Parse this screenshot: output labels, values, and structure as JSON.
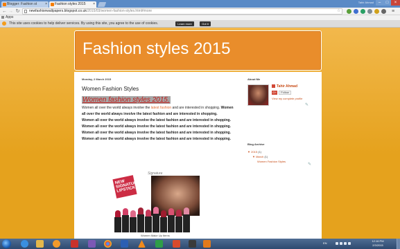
{
  "browser": {
    "tabs": [
      {
        "label": "Blogger: Fashion st"
      },
      {
        "label": "Fashion styles 2015"
      }
    ],
    "user_name": "Tahir Ahmad",
    "url_host": "newfashionwallpapers.blogspot.co.uk",
    "url_path": "/2015/03/women-fashion-styles.html#more",
    "bookmarks_label": "Apps"
  },
  "cookie_bar": {
    "text": "This site uses cookies to help deliver services. By using this site, you agree to the use of cookies.",
    "learn_more": "Learn more",
    "got_it": "Got it"
  },
  "blog": {
    "title": "Fashion styles 2015"
  },
  "post": {
    "date": "Monday, 2 March 2015",
    "title": "Women Fashion Styles",
    "heading": "Women fashion styles 2015.",
    "intro_before": "Women all over the world always involve the ",
    "intro_link": "latest fashion",
    "intro_after": " and are interested in shopping.",
    "bold_lines": [
      "Women all over the world always involve the latest fashion and are interested in shopping.",
      "Women all over the world always involve the latest fashion and are interested in shopping.",
      "Women all over the world always involve the latest fashion and are interested in shopping.",
      "Women all over the world always involve the latest fashion and are interested in shopping.",
      "Women all over the world always involve the latest fashion and are interested in shopping."
    ],
    "ad_text": "NEW SIGNATURE LIPSTICK",
    "ad_brand": "Signature",
    "ad_caption": "Women Make Up Items"
  },
  "sidebar": {
    "about_title": "About Me",
    "profile_name": "Tahir Ahmad",
    "gplus_label": "G+",
    "follow_label": "Follow",
    "profile_link": "View my complete profile",
    "archive_title": "Blog Archive",
    "archive_year": "2015",
    "archive_year_count": "(1)",
    "archive_month": "March",
    "archive_month_count": "(1)",
    "archive_post": "Women Fashion Styles"
  },
  "taskbar": {
    "language": "EN",
    "time": "12:16 PM",
    "date": "2/3/2015"
  },
  "colors": {
    "accent": "#e98d2b",
    "link": "#c74a14",
    "heading_red": "#c41a17"
  }
}
